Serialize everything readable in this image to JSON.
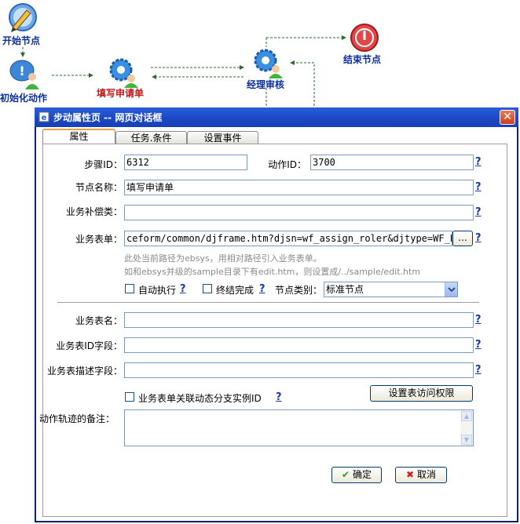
{
  "workflow": {
    "nodes": [
      {
        "name": "开始节点",
        "icon": "pen-icon"
      },
      {
        "name": "初始化动作",
        "icon": "person-bubble-icon"
      },
      {
        "name": "填写申请单",
        "icon": "gears-icon"
      },
      {
        "name": "经理审核",
        "icon": "gears-person-icon"
      },
      {
        "name": "结束节点",
        "icon": "stop-icon"
      }
    ],
    "colors": {
      "start": "#0b2f9c",
      "step": "#c01818",
      "arrow": "#2e6b2e"
    }
  },
  "dialog": {
    "title": "步动属性页 -- 网页对话框",
    "tabs": [
      {
        "label": "属性",
        "active": true
      },
      {
        "label": "任务.条件",
        "active": false
      },
      {
        "label": "设置事件",
        "active": false
      }
    ],
    "fields": {
      "step_id_label": "步骤ID：",
      "step_id_value": "6312",
      "action_id_label": "动作ID：",
      "action_id_value": "3700",
      "node_name_label": "节点名称：",
      "node_name_value": "填写申请单",
      "biz_supplement_label": "业务补偿类：",
      "biz_supplement_value": "",
      "biz_form_label": "业务表单：",
      "biz_form_value": "ceform/common/djframe.htm?djsn=wf_assign_roler&djtype=WF_EX",
      "browse_label": "...",
      "hint_line1": "此处当前路径为ebsys，用相对路径引入业务表单。",
      "hint_line2": "如和ebsys并级的sample目录下有edit.htm，则设置成/../sample/edit.htm",
      "auto_exec_label": "自动执行",
      "end_complete_label": "终结完成",
      "node_type_label": "节点类别：",
      "node_type_value": "标准节点",
      "biz_table_name_label": "业务表名：",
      "biz_table_id_label": "业务表ID字段：",
      "biz_table_desc_label": "业务表描述字段：",
      "link_instance_label": "业务表单关联动态分支实例ID",
      "table_access_button": "设置表访问权限",
      "remarks_label": "动作轨迹的备注：",
      "help_mark": "?"
    },
    "ok_label": "确定",
    "cancel_label": "取消"
  }
}
